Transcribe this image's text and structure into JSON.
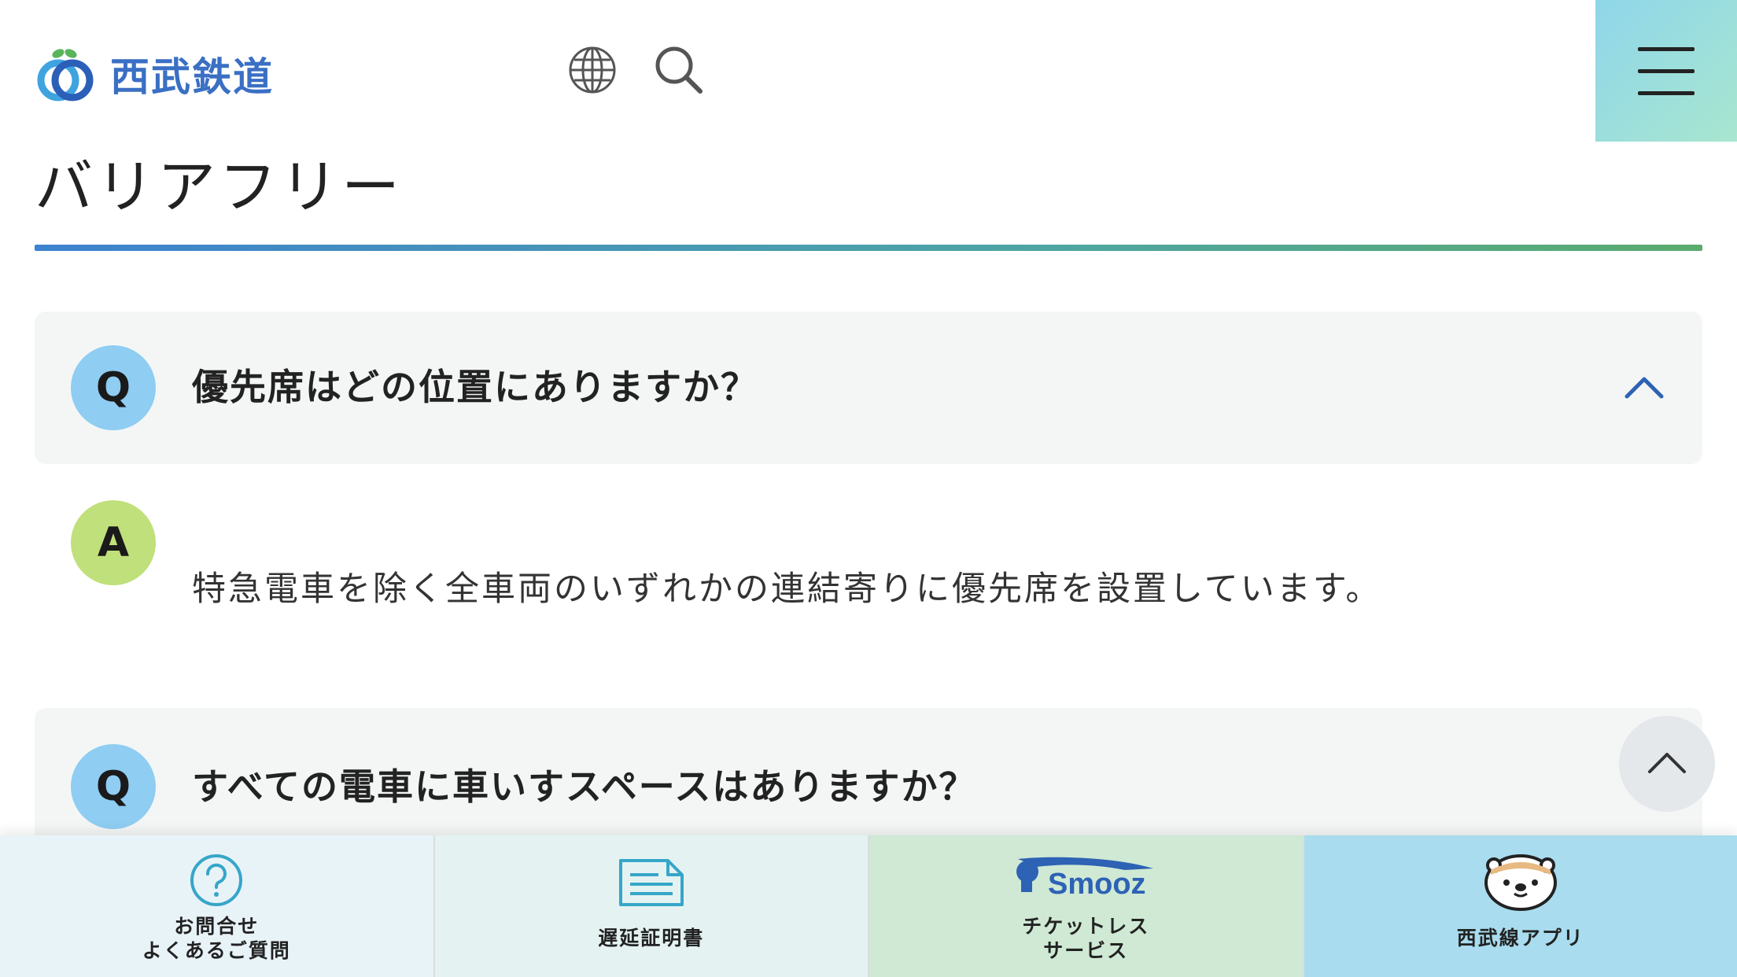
{
  "header": {
    "logo_text": "西武鉄道",
    "brand_colors": {
      "blue": "#3a6fc4",
      "green": "#5ab45a"
    },
    "icons": [
      "globe-icon",
      "search-icon",
      "hamburger-menu-icon"
    ]
  },
  "page": {
    "title": "バリアフリー"
  },
  "faq": [
    {
      "q_badge": "Q",
      "question": "優先席はどの位置にありますか？",
      "expanded": true,
      "a_badge": "A",
      "answer": "特急電車を除く全車両のいずれかの連結寄りに優先席を設置しています。"
    },
    {
      "q_badge": "Q",
      "question": "すべての電車に車いすスペースはありますか？",
      "expanded": false
    }
  ],
  "bottom_nav": {
    "items": [
      {
        "line1": "お問合せ",
        "line2": "よくあるご質問",
        "icon": "question-circle-icon"
      },
      {
        "line1": "遅延証明書",
        "icon": "document-icon"
      },
      {
        "line1": "チケットレス",
        "line2": "サービス",
        "icon": "smooz-logo",
        "logo_text": "Smooz"
      },
      {
        "line1": "西武線アプリ",
        "icon": "otter-mascot-icon"
      }
    ]
  },
  "colors": {
    "accent_gradient_start": "#3d82cf",
    "accent_gradient_end": "#5aab6e",
    "q_badge": "#8fcdf2",
    "a_badge": "#bfe07a"
  }
}
